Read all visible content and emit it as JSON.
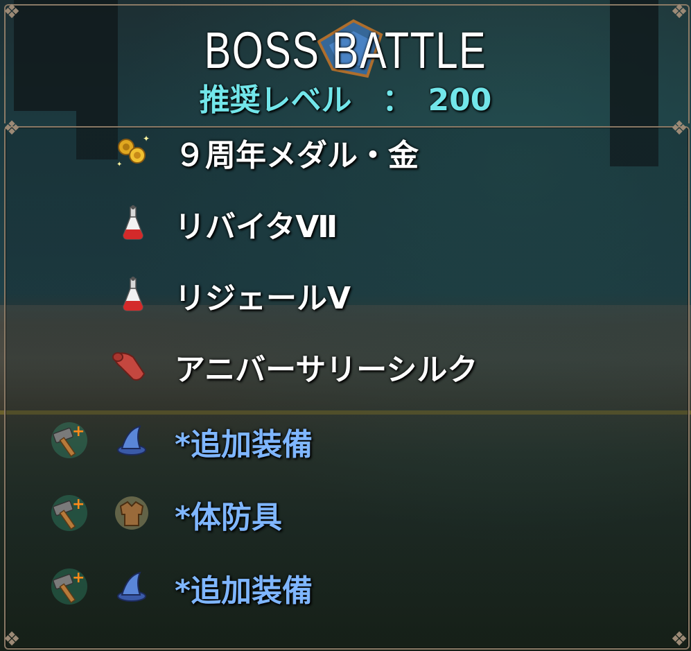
{
  "header": {
    "title": "BOSS BATTLE",
    "recommended_level": "推奨レベル　：　200"
  },
  "rewards": [
    {
      "label": "９周年メダル・金",
      "icon": "gold-medal-icon",
      "style": "white"
    },
    {
      "label": "リバイタⅦ",
      "icon": "potion-flask-icon",
      "style": "white"
    },
    {
      "label": "リジェールⅤ",
      "icon": "potion-flask-icon",
      "style": "white"
    },
    {
      "label": "アニバーサリーシルク",
      "icon": "silk-cloth-icon",
      "style": "white"
    },
    {
      "label": "*追加装備",
      "icon": "wizard-hat-icon",
      "badge": "forge-hammer-plus-icon",
      "style": "blue"
    },
    {
      "label": "*体防具",
      "icon": "body-armor-icon",
      "badge": "forge-hammer-plus-icon",
      "style": "blue"
    },
    {
      "label": "*追加装備",
      "icon": "wizard-hat-icon",
      "badge": "forge-hammer-plus-icon",
      "style": "blue"
    }
  ],
  "colors": {
    "title": "#ffffff",
    "level_text": "#72e6ea",
    "equipment_text": "#7fb6ff",
    "frame": "#8a7a66"
  }
}
